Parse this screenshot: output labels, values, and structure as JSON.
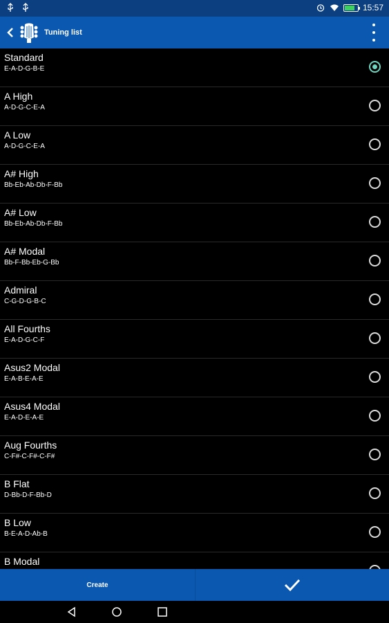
{
  "status_bar": {
    "time": "15:57"
  },
  "app_bar": {
    "title": "Tuning list"
  },
  "tunings": [
    {
      "name": "Standard",
      "notes": "E-A-D-G-B-E",
      "selected": true
    },
    {
      "name": "A High",
      "notes": "A-D-G-C-E-A",
      "selected": false
    },
    {
      "name": "A Low",
      "notes": "A-D-G-C-E-A",
      "selected": false
    },
    {
      "name": "A# High",
      "notes": "Bb-Eb-Ab-Db-F-Bb",
      "selected": false
    },
    {
      "name": "A# Low",
      "notes": "Bb-Eb-Ab-Db-F-Bb",
      "selected": false
    },
    {
      "name": "A# Modal",
      "notes": "Bb-F-Bb-Eb-G-Bb",
      "selected": false
    },
    {
      "name": "Admiral",
      "notes": "C-G-D-G-B-C",
      "selected": false
    },
    {
      "name": "All Fourths",
      "notes": "E-A-D-G-C-F",
      "selected": false
    },
    {
      "name": "Asus2 Modal",
      "notes": "E-A-B-E-A-E",
      "selected": false
    },
    {
      "name": "Asus4 Modal",
      "notes": "E-A-D-E-A-E",
      "selected": false
    },
    {
      "name": "Aug Fourths",
      "notes": "C-F#-C-F#-C-F#",
      "selected": false
    },
    {
      "name": "B Flat",
      "notes": "D-Bb-D-F-Bb-D",
      "selected": false
    },
    {
      "name": "B Low",
      "notes": "B-E-A-D-Ab-B",
      "selected": false
    },
    {
      "name": "B Modal",
      "notes": "",
      "selected": false
    }
  ],
  "bottom_bar": {
    "create_label": "Create"
  },
  "colors": {
    "primary": "#0a58b0",
    "status": "#0b3f80",
    "radio_checked": "#6fd6c0"
  }
}
